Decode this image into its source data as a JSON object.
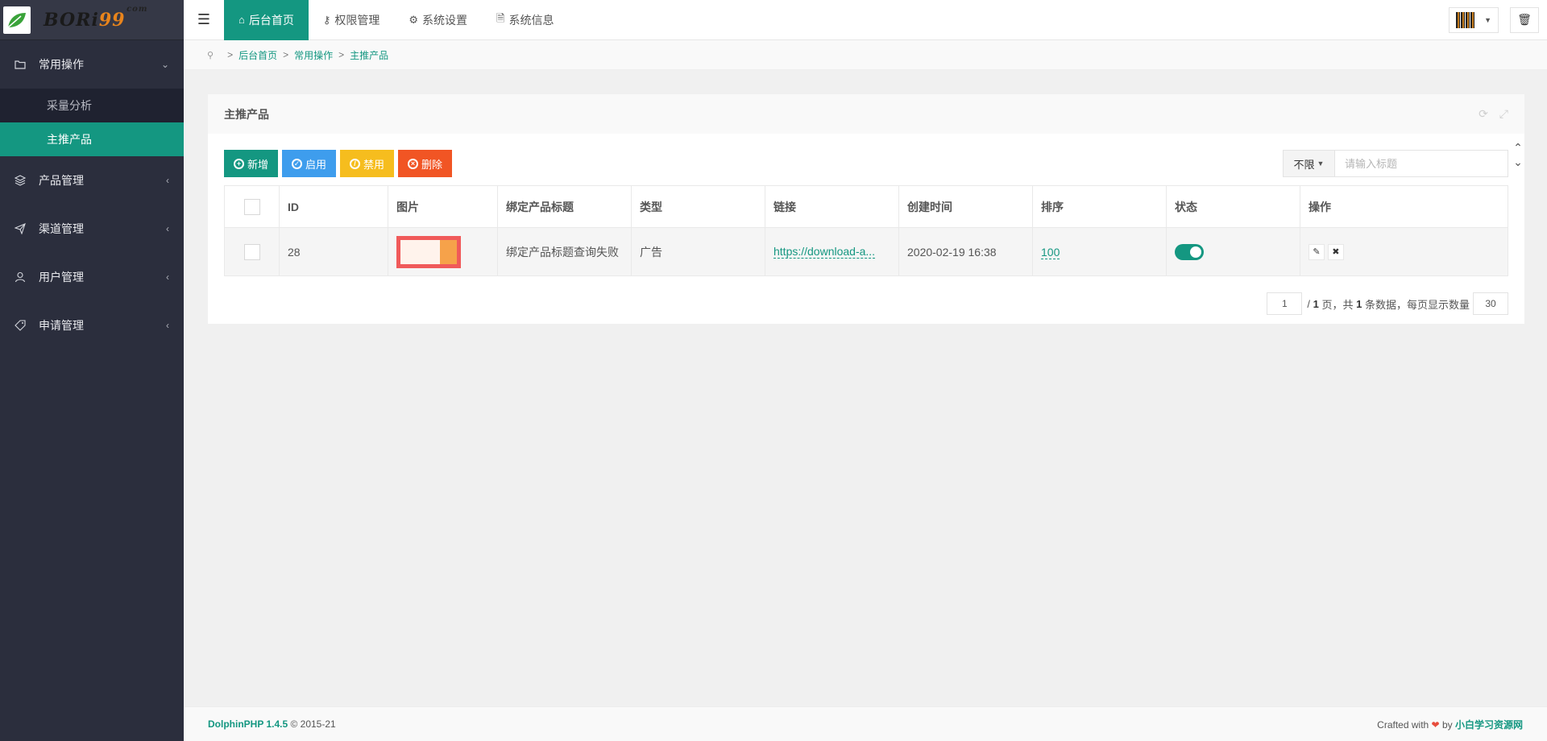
{
  "logo": {
    "text_main": "BORi",
    "text_num": "99",
    "text_suffix": "com"
  },
  "sidebar": {
    "groups": [
      {
        "label": "常用操作",
        "icon": "folder-icon",
        "chevron": "⌄",
        "expanded": true,
        "items": [
          {
            "label": "采量分析"
          },
          {
            "label": "主推产品",
            "active": true
          }
        ]
      },
      {
        "label": "产品管理",
        "icon": "layers-icon",
        "chevron": "‹"
      },
      {
        "label": "渠道管理",
        "icon": "send-icon",
        "chevron": "‹"
      },
      {
        "label": "用户管理",
        "icon": "user-icon",
        "chevron": "‹"
      },
      {
        "label": "申请管理",
        "icon": "tag-icon",
        "chevron": "‹"
      }
    ]
  },
  "topbar": {
    "tabs": [
      {
        "label": "后台首页",
        "icon": "home-icon",
        "active": true
      },
      {
        "label": "权限管理",
        "icon": "key-icon"
      },
      {
        "label": "系统设置",
        "icon": "gear-icon"
      },
      {
        "label": "系统信息",
        "icon": "document-icon"
      }
    ]
  },
  "breadcrumb": {
    "items": [
      "后台首页",
      "常用操作",
      "主推产品"
    ]
  },
  "card": {
    "title": "主推产品",
    "buttons": {
      "add": "新增",
      "enable": "启用",
      "disable": "禁用",
      "delete": "删除"
    },
    "search": {
      "filter": "不限",
      "placeholder": "请输入标题"
    },
    "table": {
      "headers": [
        "ID",
        "图片",
        "绑定产品标题",
        "类型",
        "链接",
        "创建时间",
        "排序",
        "状态",
        "操作"
      ],
      "rows": [
        {
          "id": "28",
          "title": "绑定产品标题查询失败",
          "type": "广告",
          "link": "https://download-a...",
          "created": "2020-02-19 16:38",
          "sort": "100",
          "status_on": true
        }
      ]
    },
    "pager": {
      "current": "1",
      "slash": "/",
      "total_pages": "1",
      "page_word": "页，共",
      "total_records": "1",
      "records_word": "条数据，每页显示数量",
      "per_page": "30"
    }
  },
  "footer": {
    "brand": "DolphinPHP 1.4.5",
    "copyright": "© 2015-21",
    "crafted": "Crafted with",
    "heart": "❤",
    "by": "by",
    "site": "小白学习资源网"
  },
  "colors": {
    "accent": "#149781",
    "sidebar": "#2b2e3d",
    "enable": "#3e9ded",
    "disable": "#f6bd1e",
    "delete": "#f15524"
  }
}
